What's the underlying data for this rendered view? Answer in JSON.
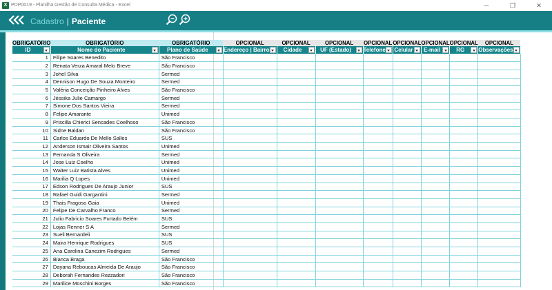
{
  "window": {
    "title": "PDP0019 - Planilha Gestão de Consulta Médica - Excel",
    "app_icon": "excel-icon",
    "buttons": [
      "─",
      "❐",
      "✕"
    ]
  },
  "banner": {
    "back_icon": "double-chevron-left-icon",
    "crumb_parent": "Cadastro",
    "crumb_separator": "|",
    "crumb_current": "Paciente",
    "zoom_out_icon": "zoom-out-icon",
    "zoom_in_icon": "zoom-in-icon",
    "colors": {
      "banner": "#167f86",
      "header": "#17868c",
      "crumb": "#79d2d8",
      "grid_line": "#7fd3db"
    }
  },
  "table": {
    "requirements": [
      "OBRIGATÓRIO",
      "OBRIGATÓRIO",
      "OBRIGATÓRIO",
      "OPCIONAL",
      "OPCIONAL",
      "OPCIONAL",
      "OPCIONAL",
      "OPCIONAL",
      "OPCIONAL",
      "OPCIONAL",
      "OPCIONAL"
    ],
    "headers": [
      "ID",
      "Nome do Paciente",
      "Plano de Saúde",
      "Endereço | Bairro",
      "Cidade",
      "UF (Estado)",
      "Telefone",
      "Celular",
      "E-mail",
      "RG",
      "Observações"
    ],
    "rows": [
      {
        "id": "1",
        "name": "Filipe Soares Benedito",
        "plan": "São Francisco"
      },
      {
        "id": "2",
        "name": "Renata Verza Amaral Melo Breve",
        "plan": "São Francisco"
      },
      {
        "id": "3",
        "name": "Johel Silva",
        "plan": "Sermed"
      },
      {
        "id": "4",
        "name": "Dennison Hugo De Souza Monteiro",
        "plan": "Sermed"
      },
      {
        "id": "5",
        "name": "Valéria Conceição Pinheiro Alves",
        "plan": "São Francisco"
      },
      {
        "id": "6",
        "name": "Jéssika Julie Camargo",
        "plan": "Sermed"
      },
      {
        "id": "7",
        "name": "Simone Dos Santos Vieira",
        "plan": "Sermed"
      },
      {
        "id": "8",
        "name": "Felipe Amarante",
        "plan": "Unimed"
      },
      {
        "id": "9",
        "name": "Priscilla Chierici Sencades Coelhoso",
        "plan": "São Francisco"
      },
      {
        "id": "10",
        "name": "Sidne Baldan",
        "plan": "São Francisco"
      },
      {
        "id": "11",
        "name": "Carlos Eduardo De Mello Salles",
        "plan": "SUS"
      },
      {
        "id": "12",
        "name": "Anderson Ismair Oliveira Santos",
        "plan": "Unimed"
      },
      {
        "id": "13",
        "name": "Fernanda S Oliveira",
        "plan": "Sermed"
      },
      {
        "id": "14",
        "name": "Jose Luiz Coelho",
        "plan": "Unimed"
      },
      {
        "id": "15",
        "name": "Walter Luiz Batista Alves",
        "plan": "Unimed"
      },
      {
        "id": "16",
        "name": "Marilia Q Lopes",
        "plan": "Unimed"
      },
      {
        "id": "17",
        "name": "Edson Rodrigues De Araujo Junior",
        "plan": "SUS"
      },
      {
        "id": "18",
        "name": "Rafael Guidi Gargantini",
        "plan": "Sermed"
      },
      {
        "id": "19",
        "name": "Thais Fragoso Gaia",
        "plan": "Unimed"
      },
      {
        "id": "20",
        "name": "Felipe De Carvalho Franco",
        "plan": "Sermed"
      },
      {
        "id": "21",
        "name": "Julio Fabricio Soares Furtado Belém",
        "plan": "SUS"
      },
      {
        "id": "22",
        "name": "Lojas Renner S A",
        "plan": "Sermed"
      },
      {
        "id": "23",
        "name": "Sueli Bernardeli",
        "plan": "SUS"
      },
      {
        "id": "24",
        "name": "Maira Henrique Rodrigues",
        "plan": "SUS"
      },
      {
        "id": "25",
        "name": "Ana Carolina Canezim Rodrigues",
        "plan": "Sermed"
      },
      {
        "id": "26",
        "name": "Bianca Braga",
        "plan": "São Francisco"
      },
      {
        "id": "27",
        "name": "Dayana Reboucas Almeida De Araujo",
        "plan": "São Francisco"
      },
      {
        "id": "28",
        "name": "Deborah Fernandes Rezzadori",
        "plan": "São Francisco"
      },
      {
        "id": "29",
        "name": "Marilice Moschini Borges",
        "plan": "São Francisco"
      }
    ]
  }
}
